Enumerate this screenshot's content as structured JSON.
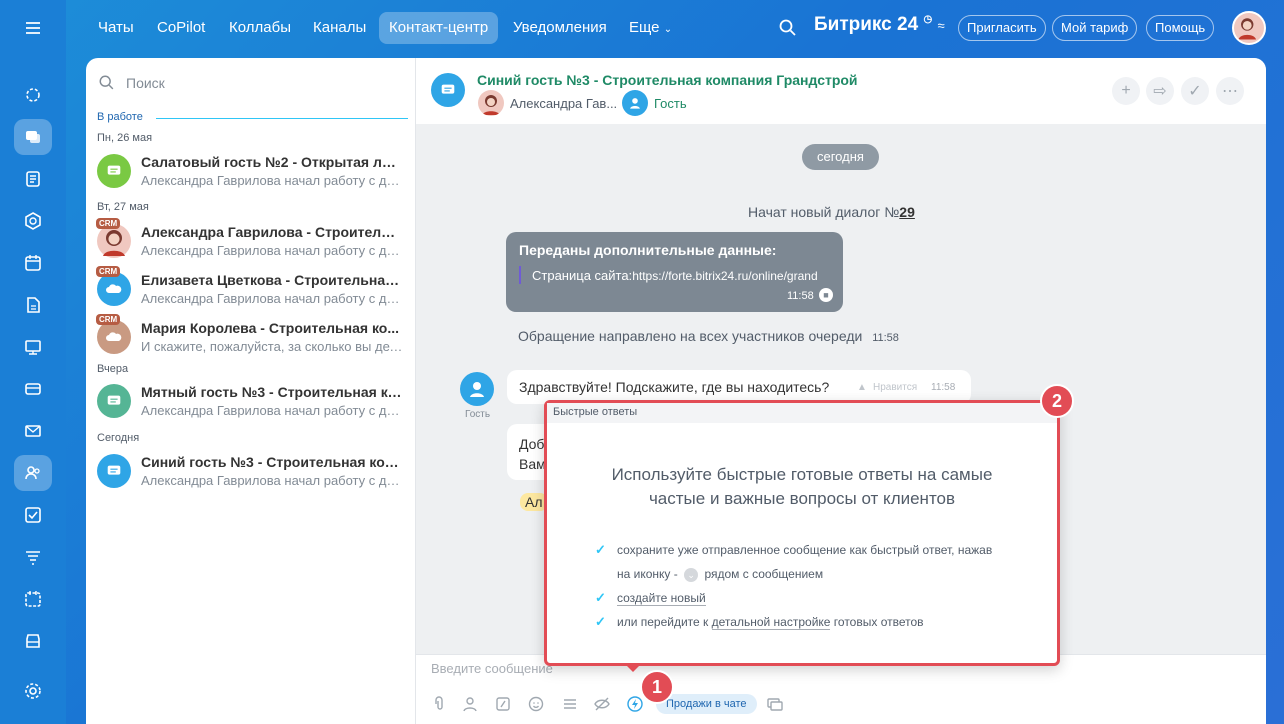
{
  "topbar": {
    "tabs": [
      "Чаты",
      "CoPilot",
      "Коллабы",
      "Каналы",
      "Контакт-центр",
      "Уведомления",
      "Еще"
    ],
    "active_tab": "Контакт-центр",
    "brand": "Битрикс",
    "brand_num": "24",
    "buttons": [
      "Пригласить",
      "Мой тариф",
      "Помощь"
    ]
  },
  "sidebar": {
    "search_placeholder": "Поиск",
    "section": "В работе",
    "groups": [
      {
        "date": "Пн, 26 мая"
      },
      {
        "date": "Вт, 27 мая"
      },
      {
        "date": "Вчера"
      },
      {
        "date": "Сегодня"
      }
    ],
    "chats": [
      {
        "title": "Салатовый гость №2 - Открытая лин...",
        "subtitle": "Александра Гаврилова начал работу с ди..."
      },
      {
        "title": "Александра Гаврилова - Строительн...",
        "subtitle": "Александра Гаврилова начал работу с ди...",
        "badge": "CRM"
      },
      {
        "title": "Елизавета Цветкова - Строительная ...",
        "subtitle": "Александра Гаврилова начал работу с ди...",
        "badge": "CRM"
      },
      {
        "title": "Мария Королева - Строительная ко...",
        "subtitle": "И скажите, пожалуйста, за сколько вы дел...",
        "badge": "CRM"
      },
      {
        "title": "Мятный гость №3 - Строительная ко...",
        "subtitle": "Александра Гаврилова начал работу с ди..."
      },
      {
        "title": "Синий гость №3 - Строительная ком...",
        "subtitle": "Александра Гаврилова начал работу с ди..."
      }
    ]
  },
  "chat": {
    "title": "Синий гость №3 - Строительная компания Грандстрой",
    "operator": "Александра Гав...",
    "guest": "Гость",
    "date_pill": "сегодня",
    "new_dialog": "Начат новый диалог №",
    "dialog_number": "29",
    "data_title": "Переданы дополнительные данные:",
    "data_line_label": "Страница сайта:",
    "data_line_url": "https://forte.bitrix24.ru/online/grand",
    "data_time": "11:58",
    "queue_text": "Обращение направлено на всех участников очереди",
    "queue_time": "11:58",
    "guest_label": "Гость",
    "msg1": "Здравствуйте! Подскажите, где вы находитесь?",
    "msg1_like": "Нравится",
    "msg1_time": "11:58",
    "msg2_partial1": "Доб",
    "msg2_partial2": "Вам",
    "msg3_partial": "Ал",
    "input_placeholder": "Введите сообщение",
    "sales_button": "Продажи в чате"
  },
  "popup": {
    "header": "Быстрые ответы",
    "title_line1": "Используйте быстрые готовые ответы на самые",
    "title_line2": "частые и важные вопросы от клиентов",
    "item1_line1": "сохраните уже отправленное сообщение как быстрый ответ, нажав",
    "item1_line2a": "на иконку -",
    "item1_line2b": "рядом с сообщением",
    "item2": "создайте новый",
    "item3a": "или перейдите к",
    "item3_link": "детальной настройке",
    "item3b": "готовых ответов"
  },
  "markers": {
    "one": "1",
    "two": "2"
  },
  "colors": {
    "accent": "#2fc6f6",
    "marker": "#e24c55",
    "link_green": "#1f8a66",
    "rail": "#1b7fd6"
  }
}
